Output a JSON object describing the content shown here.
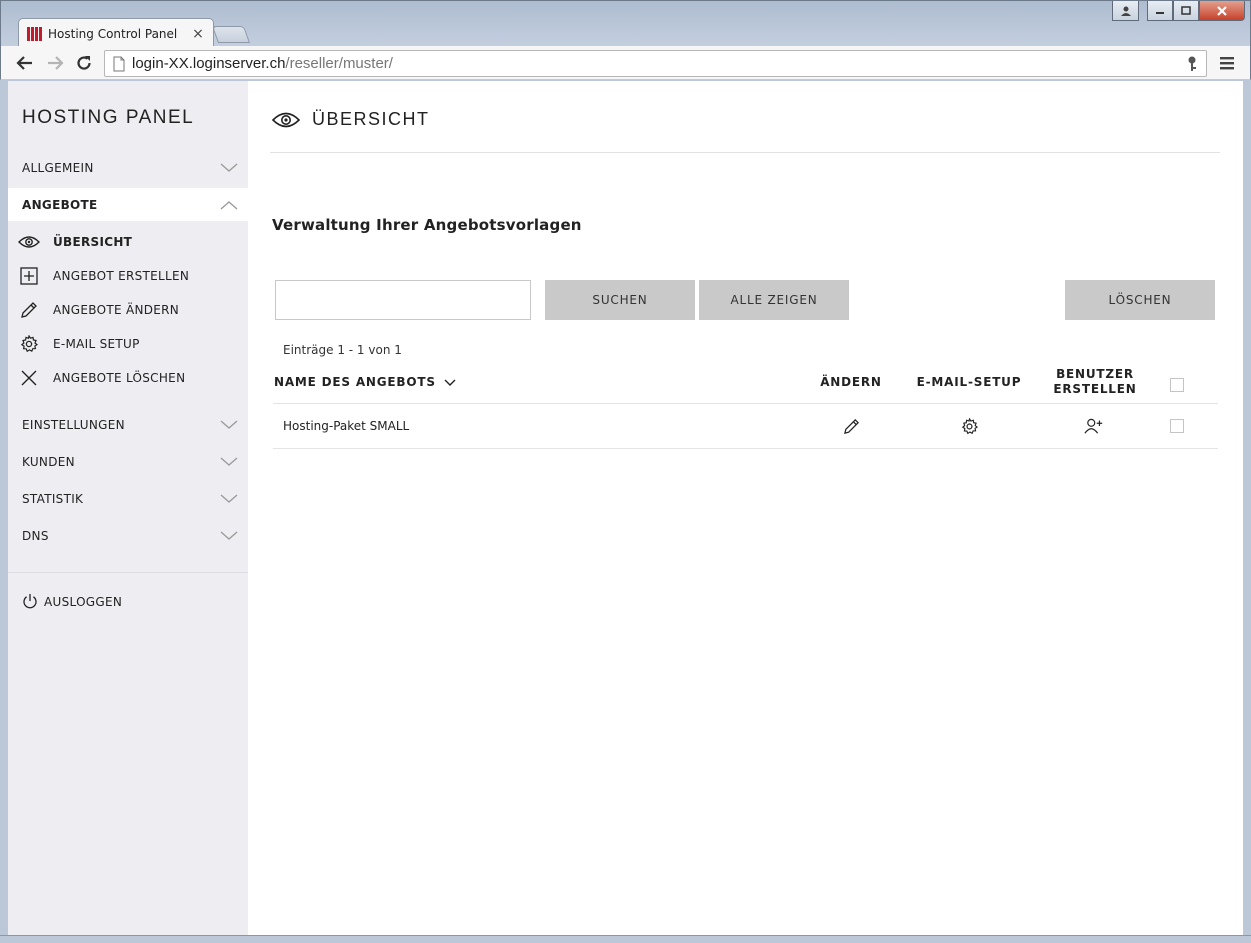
{
  "browser": {
    "tab_title": "Hosting Control Panel",
    "tab_close": "×",
    "url_host": "login-XX.loginserver.ch",
    "url_path": "/reseller/muster/"
  },
  "sidebar": {
    "brand": "HOSTING PANEL",
    "sections": {
      "allgemein": "ALLGEMEIN",
      "angebote": "ANGEBOTE",
      "einstellungen": "EINSTELLUNGEN",
      "kunden": "KUNDEN",
      "statistik": "STATISTIK",
      "dns": "DNS"
    },
    "subitems": {
      "uebersicht": "ÜBERSICHT",
      "erstellen": "ANGEBOT ERSTELLEN",
      "aendern": "ANGEBOTE ÄNDERN",
      "email_setup": "E-MAIL SETUP",
      "loeschen": "ANGEBOTE LÖSCHEN"
    },
    "logout": "AUSLOGGEN"
  },
  "main": {
    "title": "ÜBERSICHT",
    "heading": "Verwaltung Ihrer Angebotsvorlagen",
    "search_value": "",
    "buttons": {
      "search": "SUCHEN",
      "show_all": "ALLE ZEIGEN",
      "delete": "LÖSCHEN"
    },
    "entries": "Einträge 1 - 1 von 1",
    "table": {
      "col_name": "NAME DES ANGEBOTS",
      "col_edit": "ÄNDERN",
      "col_email": "E-MAIL-SETUP",
      "col_user_line1": "BENUTZER",
      "col_user_line2": "ERSTELLEN",
      "rows": [
        {
          "name": "Hosting-Paket SMALL"
        }
      ]
    }
  }
}
